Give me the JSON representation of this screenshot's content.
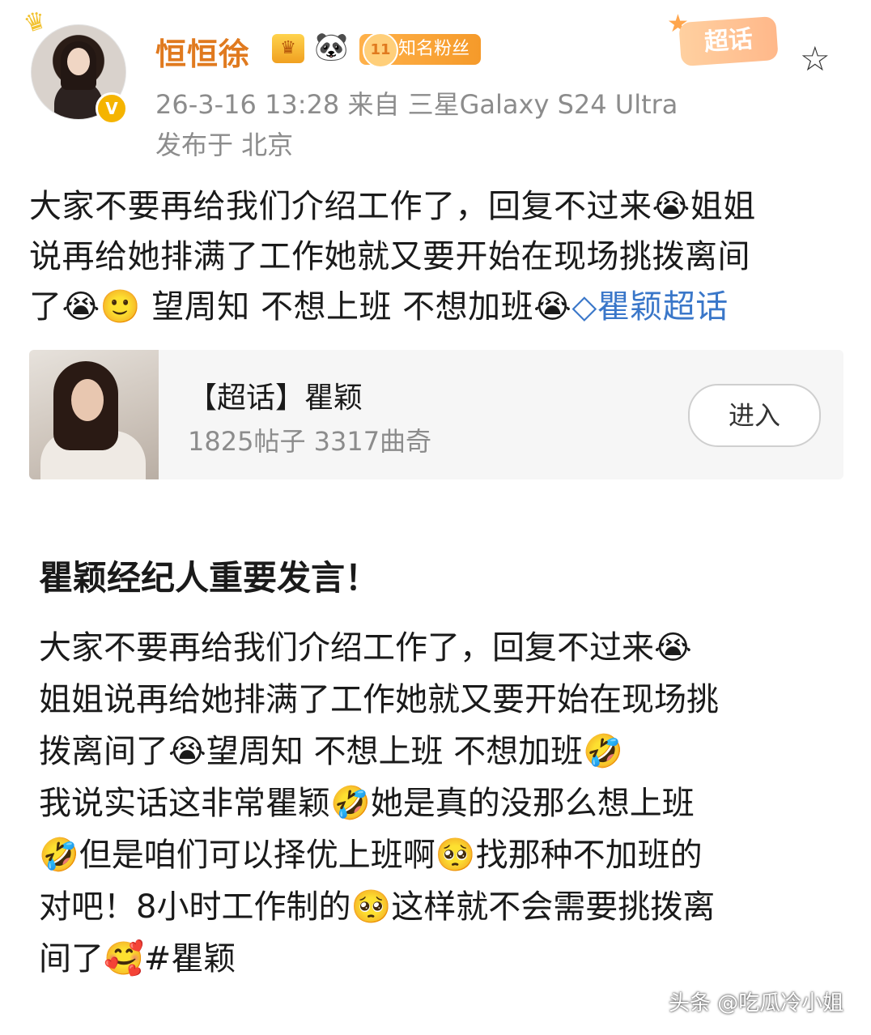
{
  "header": {
    "username": "恒恒徐",
    "fan_badge": "知名粉丝",
    "fan_level": "11",
    "meta_line": "26-3-16 13:28   来自 三星Galaxy S24 Ultra",
    "location": "发布于 北京",
    "supertopic_badge": "超话",
    "icons": [
      "crown-icon",
      "vip-icon",
      "panda-icon",
      "star-icon",
      "verified-icon"
    ]
  },
  "post": {
    "line1": "大家不要再给我们介绍工作了，回复不过来😭姐姐",
    "line2": "说再给她排满了工作她就又要开始在现场挑拨离间",
    "line3_a": "了😭🙂 望周知 不想上班 不想加班😭",
    "line3_link": "◇瞿颖超话"
  },
  "topic_card": {
    "title": "【超话】瞿颖",
    "stats": "1825帖子 3317曲奇",
    "enter_label": "进入"
  },
  "article": {
    "title": "瞿颖经纪人重要发言！",
    "lines": [
      "大家不要再给我们介绍工作了，回复不过来😭",
      "姐姐说再给她排满了工作她就又要开始在现场挑",
      "拨离间了😭望周知 不想上班 不想加班🤣",
      "我说实话这非常瞿颖🤣她是真的没那么想上班",
      "🤣但是咱们可以择优上班啊🥺找那种不加班的",
      "对吧！8小时工作制的🥺这样就不会需要挑拨离",
      "间了🥰#瞿颖"
    ]
  },
  "watermark": "头条 @吃瓜冷小姐",
  "colors": {
    "username": "#e07a1f",
    "meta": "#8c8c8c",
    "link": "#3a77c9",
    "fan_badge": "#f59a2a"
  }
}
